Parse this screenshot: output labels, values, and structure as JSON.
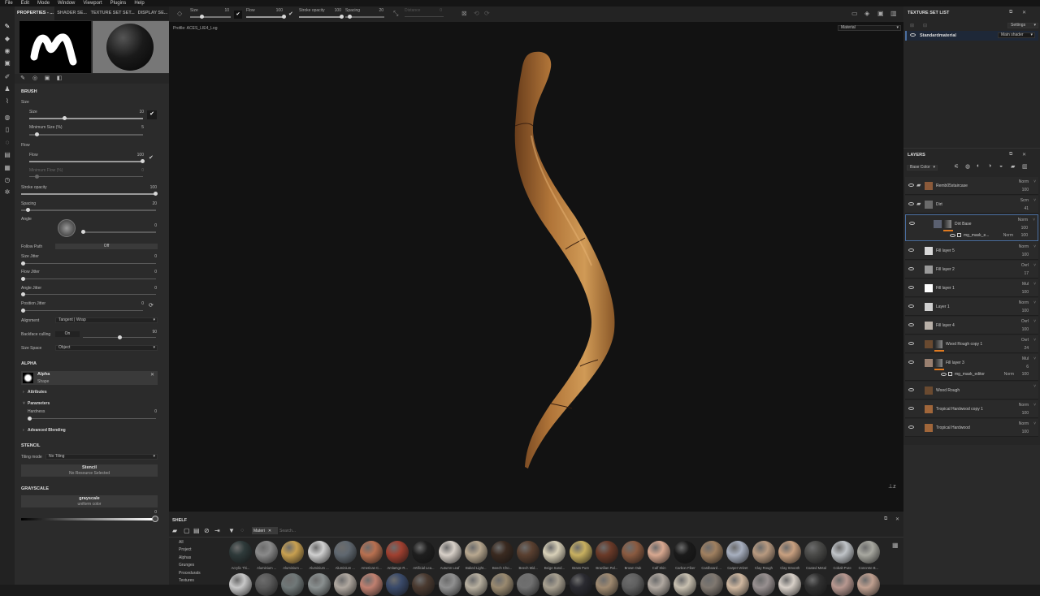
{
  "menubar": [
    "File",
    "Edit",
    "Mode",
    "Window",
    "Viewport",
    "Plugins",
    "Help"
  ],
  "left_tabs": [
    "PROPERTIES - ...",
    "SHADER SE...",
    "TEXTURE SET SET...",
    "DISPLAY SE..."
  ],
  "brush": {
    "section": "BRUSH",
    "size_group": "Size",
    "size_label": "Size",
    "size_value": "10",
    "min_size_label": "Minimum Size (%)",
    "min_size_value": "5",
    "flow_group": "Flow",
    "flow_label": "Flow",
    "flow_value": "100",
    "min_flow_label": "Minimum Flow (%)",
    "min_flow_value": "0",
    "stroke_opacity_label": "Stroke opacity",
    "stroke_opacity_value": "100",
    "spacing_label": "Spacing",
    "spacing_value": "20",
    "angle_label": "Angle",
    "angle_value": "0",
    "follow_path_label": "Follow Path",
    "follow_path_value": "Off",
    "size_jitter_label": "Size Jitter",
    "size_jitter_value": "0",
    "flow_jitter_label": "Flow Jitter",
    "flow_jitter_value": "0",
    "angle_jitter_label": "Angle Jitter",
    "angle_jitter_value": "0",
    "position_jitter_label": "Position Jitter",
    "position_jitter_value": "0",
    "alignment_label": "Alignment",
    "alignment_value": "Tangent | Wrap",
    "backface_label": "Backface culling",
    "backface_value": "On",
    "backface_num": "90",
    "size_space_label": "Size Space",
    "size_space_value": "Object"
  },
  "alpha": {
    "section": "ALPHA",
    "name": "Alpha",
    "type": "Shape",
    "attributes": "Attributes",
    "parameters": "Parameters",
    "hardness_label": "Hardness",
    "hardness_value": "0",
    "advanced": "Advanced Blending"
  },
  "stencil": {
    "section": "STENCIL",
    "tiling_label": "Tiling mode",
    "tiling_value": "No Tiling",
    "title": "Stencil",
    "sub": "No Resource Selected"
  },
  "grayscale": {
    "section": "GRAYSCALE",
    "title": "grayscale",
    "sub": "uniform color",
    "value": "0"
  },
  "topbar": {
    "size_label": "Size",
    "size_value": "10",
    "flow_label": "Flow",
    "flow_value": "100",
    "stroke_label": "Stroke opacity",
    "stroke_value": "100",
    "spacing_label": "Spacing",
    "spacing_value": "20",
    "distance_label": "Distance",
    "distance_value": "0"
  },
  "viewport": {
    "profile": "Profile: ACES_LIE4_Log",
    "mode": "Material"
  },
  "texture_set": {
    "title": "TEXTURE SET LIST",
    "settings": "Settings",
    "material": "Standardmaterial",
    "shader": "Main shader"
  },
  "layers": {
    "title": "LAYERS",
    "channel": "Base Color",
    "items": [
      {
        "name": "Remb05staircase",
        "mode": "Norm",
        "op": "100",
        "color": "#8b5a3a",
        "kind": "folder"
      },
      {
        "name": "Dirt",
        "mode": "Scrn",
        "op": "41",
        "color": "#6a6a6a",
        "kind": "folder"
      },
      {
        "name": "Dirt Base",
        "mode": "Norm",
        "op": "100",
        "color": "#5a6070",
        "kind": "fill",
        "mask": "mg_mask_e...",
        "mask_mode": "Norm",
        "mask_op": "100"
      },
      {
        "name": "Fill layer 5",
        "mode": "Norm",
        "op": "100",
        "color": "#d8d8d8",
        "kind": "fill"
      },
      {
        "name": "Fill layer 2",
        "mode": "Ovrl",
        "op": "17",
        "color": "#9a9a9a",
        "kind": "fill"
      },
      {
        "name": "Fill layer 1",
        "mode": "Mul",
        "op": "100",
        "color": "#ffffff",
        "kind": "fill"
      },
      {
        "name": "Layer 1",
        "mode": "Norm",
        "op": "100",
        "color": "#d0d0d0",
        "kind": "paint"
      },
      {
        "name": "Fill layer 4",
        "mode": "Ovrl",
        "op": "100",
        "color": "#b8b0a8",
        "kind": "fill"
      },
      {
        "name": "Wood Rough copy 1",
        "mode": "Ovrl",
        "op": "24",
        "color": "#6a4a30",
        "kind": "fill"
      },
      {
        "name": "Fill layer 3",
        "mode": "Mul",
        "op": "6",
        "color": "#9a8070",
        "kind": "fill",
        "mask": "mg_mask_editor",
        "mask_mode": "Norm",
        "mask_op": "100"
      },
      {
        "name": "Wood Rough",
        "mode": "",
        "op": "",
        "color": "#6a4a30",
        "kind": "fill"
      },
      {
        "name": "Tropical Hardwood copy 1",
        "mode": "Norm",
        "op": "100",
        "color": "#a0663a",
        "kind": "fill"
      },
      {
        "name": "Tropical Hardwood",
        "mode": "Norm",
        "op": "100",
        "color": "#a0663a",
        "kind": "fill"
      }
    ]
  },
  "shelf": {
    "title": "SHELF",
    "filter": "Materi",
    "search_placeholder": "Search...",
    "categories": [
      "All",
      "Project",
      "Alphas",
      "Grunges",
      "Procedurals",
      "Textures"
    ],
    "materials": [
      {
        "name": "Acrylic Thi...",
        "color": "#2e3a3a"
      },
      {
        "name": "Aluminium ...",
        "color": "#8a8a8a"
      },
      {
        "name": "Aluminium ...",
        "color": "#c8a050"
      },
      {
        "name": "Aluminium ...",
        "color": "#d0d0d0"
      },
      {
        "name": "Aluminium ...",
        "color": "#606870"
      },
      {
        "name": "American C...",
        "color": "#b87050"
      },
      {
        "name": "Amlamgn R...",
        "color": "#a04030"
      },
      {
        "name": "Artificial Lea...",
        "color": "#1e1e1e"
      },
      {
        "name": "Autumn Leaf",
        "color": "#d8d0c8"
      },
      {
        "name": "Baked Light...",
        "color": "#b8a890"
      },
      {
        "name": "Beech Cho...",
        "color": "#3a2a20"
      },
      {
        "name": "Beech Mid...",
        "color": "#5a4030"
      },
      {
        "name": "Beige Sand...",
        "color": "#d8d0b8"
      },
      {
        "name": "Brass Pure",
        "color": "#c8b060"
      },
      {
        "name": "Brazilian Pal...",
        "color": "#6a3a28"
      },
      {
        "name": "Brown Oak",
        "color": "#8a5a40"
      },
      {
        "name": "Calf Skin",
        "color": "#d8a890"
      },
      {
        "name": "Carbon Fiber",
        "color": "#1a1a1a"
      },
      {
        "name": "Cardboard ...",
        "color": "#a08060"
      },
      {
        "name": "Carpet Velvet",
        "color": "#a8b0c0"
      },
      {
        "name": "Clay Rough",
        "color": "#b89a80"
      },
      {
        "name": "Clay Smooth",
        "color": "#c8a080"
      },
      {
        "name": "Coated Metal",
        "color": "#4a4a48"
      },
      {
        "name": "Cobalt Pure",
        "color": "#c0c4c8"
      },
      {
        "name": "Concrete B...",
        "color": "#a8a8a0"
      }
    ],
    "row2_colors": [
      "#c8c8c8",
      "#5a5a5a",
      "#707878",
      "#8a9090",
      "#b0a8a0",
      "#c08070",
      "#3a4a6a",
      "#4a3a30",
      "#909090",
      "#b8b0a0",
      "#9a8a70",
      "#707070",
      "#a8a090",
      "#2a2a30",
      "#a08a70",
      "#606060",
      "#b0a8a0",
      "#c8c0b0",
      "#807870",
      "#d0b8a0",
      "#989090",
      "#d8d0c8",
      "#303030",
      "#b89890",
      "#c0a090"
    ]
  }
}
